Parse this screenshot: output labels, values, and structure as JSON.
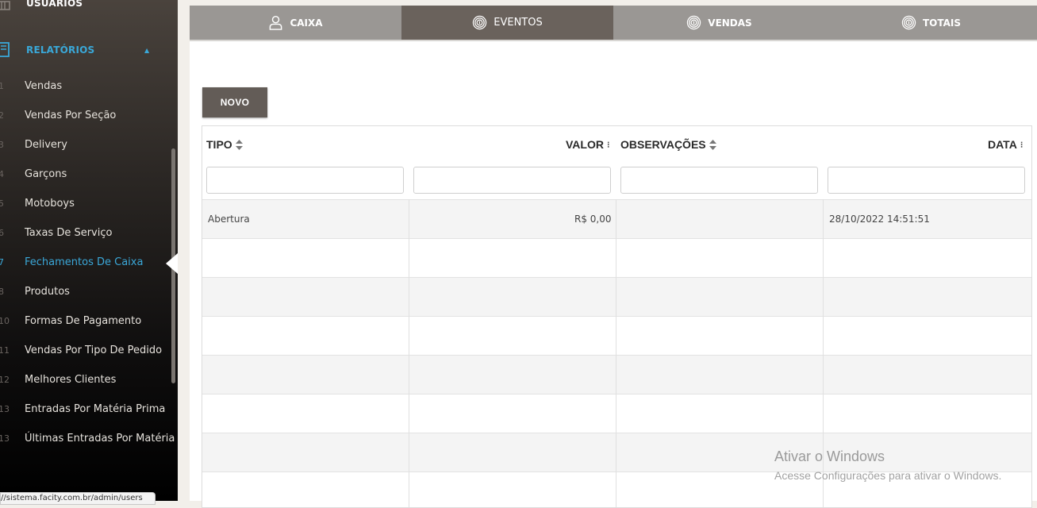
{
  "sidebar": {
    "users_label": "USUÁRIOS",
    "reports_label": "RELATÓRIOS",
    "items": [
      {
        "num": "1",
        "label": "Vendas"
      },
      {
        "num": "2",
        "label": "Vendas Por Seção"
      },
      {
        "num": "3",
        "label": "Delivery"
      },
      {
        "num": "4",
        "label": "Garçons"
      },
      {
        "num": "5",
        "label": "Motoboys"
      },
      {
        "num": "6",
        "label": "Taxas De Serviço"
      },
      {
        "num": "7",
        "label": "Fechamentos De Caixa"
      },
      {
        "num": "8",
        "label": "Produtos"
      },
      {
        "num": "10",
        "label": "Formas De Pagamento"
      },
      {
        "num": "11",
        "label": "Vendas Por Tipo De Pedido"
      },
      {
        "num": "12",
        "label": "Melhores Clientes"
      },
      {
        "num": "13",
        "label": "Entradas Por Matéria Prima"
      },
      {
        "num": "13",
        "label": "Últimas Entradas Por Matéria Prima"
      }
    ],
    "active_item": "Fechamentos De Caixa"
  },
  "status_url": "//sistema.facity.com.br/admin/users",
  "tabs": [
    {
      "label": "CAIXA",
      "icon": "user-icon",
      "active": false
    },
    {
      "label": "EVENTOS",
      "icon": "fingerprint-icon",
      "active": true
    },
    {
      "label": "VENDAS",
      "icon": "fingerprint-icon",
      "active": false
    },
    {
      "label": "TOTAIS",
      "icon": "fingerprint-icon",
      "active": false
    }
  ],
  "toolbar": {
    "new_label": "NOVO"
  },
  "table": {
    "columns": [
      "TIPO",
      "VALOR",
      "OBSERVAÇÕES",
      "DATA"
    ],
    "rows": [
      {
        "tipo": "Abertura",
        "valor": "R$ 0,00",
        "observacoes": "",
        "data": "28/10/2022 14:51:51"
      }
    ]
  },
  "watermark": {
    "line1": "Ativar o Windows",
    "line2": "Acesse Configurações para ativar o Windows."
  },
  "colors": {
    "accent": "#3aa8d8",
    "tab_active": "#6a625c",
    "tab_inactive": "#9a9794",
    "button": "#635c57"
  }
}
